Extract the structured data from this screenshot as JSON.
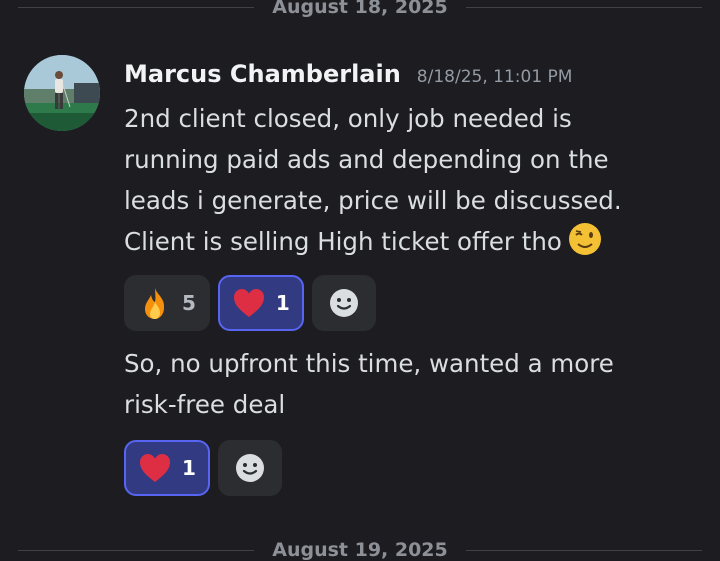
{
  "dividers": {
    "top": "August 18, 2025",
    "bottom": "August 19, 2025"
  },
  "message": {
    "author": "Marcus Chamberlain",
    "timestamp": "8/18/25, 11:01 PM",
    "avatar_icon": "golfer-avatar",
    "first": {
      "text": "2nd client closed, only job needed is\nrunning paid ads and depending on the\nleads i generate, price will be discussed.\nClient is selling High ticket offer tho",
      "emoji_icon": "winking-face-icon",
      "reactions": [
        {
          "emoji_icon": "fire-icon",
          "count": "5",
          "active": false
        },
        {
          "emoji_icon": "heart-icon",
          "count": "1",
          "active": true
        }
      ]
    },
    "second": {
      "text": "So, no upfront this time, wanted a more\nrisk-free deal",
      "reactions": [
        {
          "emoji_icon": "heart-icon",
          "count": "1",
          "active": true
        }
      ]
    },
    "add_reaction_icon": "add-reaction-smiley-icon"
  },
  "colors": {
    "background": "#1c1c21",
    "active_reaction_bg": "#323a82",
    "active_reaction_border": "#5865f2"
  }
}
